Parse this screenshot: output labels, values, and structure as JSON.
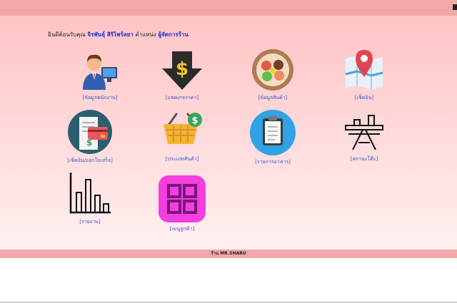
{
  "welcome": {
    "prefix": "ยินดีต้อนรับคุณ",
    "name": "จิรพันธุ์  สิริไพร์ลยา",
    "position_prefix": "ตำแหน่ง",
    "role": "ผู้จัดการร้าน"
  },
  "menu": [
    {
      "label": "[ข้อมูลพนักงาน]",
      "icon": "employee-icon"
    },
    {
      "label": "[แพคเกจราคา]",
      "icon": "price-package-icon"
    },
    {
      "label": "[ข้อมูลสินค้า]",
      "icon": "food-bowl-icon"
    },
    {
      "label": "[เช็คอิน]",
      "icon": "map-pin-icon"
    },
    {
      "label": "[เช็คอิน/ออกใบเสร็จ]",
      "icon": "receipt-card-icon"
    },
    {
      "label": "[ประเภทสินค้า]",
      "icon": "basket-icon"
    },
    {
      "label": "[รายการอาหาร]",
      "icon": "clipboard-icon"
    },
    {
      "label": "[สถานะโต๊ะ]",
      "icon": "table-icon"
    },
    {
      "label": "[รายงาน]",
      "icon": "bar-chart-icon"
    },
    {
      "label": "[เมนูลูกค้า]",
      "icon": "grid-menu-icon"
    }
  ],
  "footer": {
    "text": "ร้าน MR.SHABU"
  },
  "colors": {
    "bar": "#f2a7a9",
    "link": "#3a52c8",
    "accent": "#1a2bd6"
  }
}
